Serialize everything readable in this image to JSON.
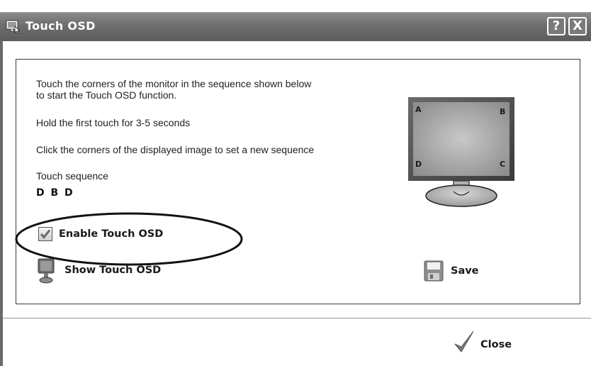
{
  "window": {
    "title": "Touch OSD",
    "help_label": "?",
    "close_label": "X"
  },
  "instructions": {
    "line1": "Touch the corners of the monitor in the sequence shown below",
    "line2": "to start the Touch OSD function.",
    "hold": "Hold the first touch for 3-5 seconds",
    "click": "Click the corners of the displayed image to set a new sequence",
    "sequence_label": "Touch sequence",
    "sequence_value": "D B D"
  },
  "monitor": {
    "corner_a": "A",
    "corner_b": "B",
    "corner_c": "C",
    "corner_d": "D"
  },
  "enable": {
    "label": "Enable Touch OSD",
    "checked": true
  },
  "actions": {
    "show_label": "Show Touch OSD",
    "save_label": "Save",
    "close_label": "Close"
  },
  "icons": {
    "title": "touch-osd-app-icon",
    "show": "monitor-icon",
    "save": "floppy-disk-icon",
    "close": "checkmark-icon"
  }
}
